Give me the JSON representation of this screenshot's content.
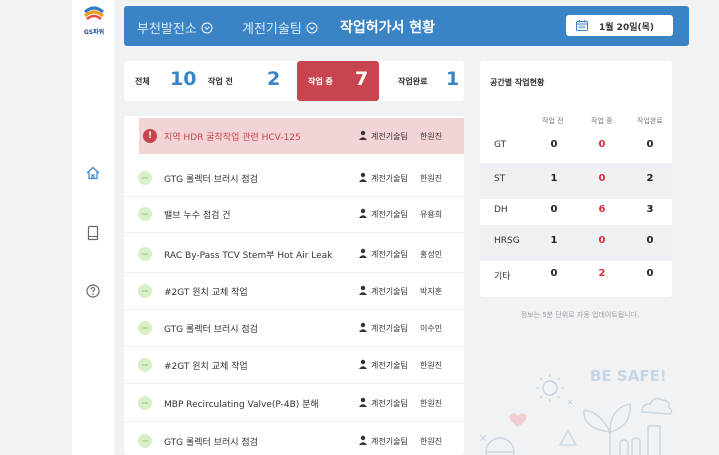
{
  "brand": {
    "logo_text": "GS파워"
  },
  "header": {
    "plant": "부천발전소",
    "team": "계전기술팀",
    "title": "작업허가서 현황",
    "date": "1월 20일(목)"
  },
  "tabs": [
    {
      "label": "전체",
      "count": "10"
    },
    {
      "label": "작업 전",
      "count": "2"
    },
    {
      "label": "작업 중",
      "count": "7",
      "active": true
    },
    {
      "label": "작업완료",
      "count": "1"
    }
  ],
  "works": [
    {
      "title": "지역 HDR 굴착작업 관련 HCV-125",
      "team": "계전기술팀",
      "name": "한원진",
      "alert": true
    },
    {
      "title": "GTG 롤렉터 브러시 점검",
      "team": "계전기술팀",
      "name": "한원진"
    },
    {
      "title": "밸브 누수 점검 건",
      "team": "계전기술팀",
      "name": "유용희"
    },
    {
      "title": "RAC By-Pass TCV Stem부 Hot Air Leak",
      "team": "계전기술팀",
      "name": "홍성민"
    },
    {
      "title": "#2GT 윈치 교체 작업",
      "team": "계전기술팀",
      "name": "박지훈"
    },
    {
      "title": "GTG 롤렉터 브러시 점검",
      "team": "계전기술팀",
      "name": "이수민"
    },
    {
      "title": "#2GT 윈치 교체 작업",
      "team": "계전기술팀",
      "name": "한원진"
    },
    {
      "title": "MBP Recirculating Valve(P-4B) 분해",
      "team": "계전기술팀",
      "name": "한원진"
    },
    {
      "title": "GTG 롤렉터 브러시 점검",
      "team": "계전기술팀",
      "name": "한원진"
    }
  ],
  "area_panel": {
    "title": "공간별 작업현황",
    "columns": [
      "작업 전",
      "작업 중",
      "작업완료"
    ],
    "rows": [
      {
        "name": "GT",
        "before": "0",
        "during": "0",
        "done": "0"
      },
      {
        "name": "ST",
        "before": "1",
        "during": "0",
        "done": "2"
      },
      {
        "name": "DH",
        "before": "0",
        "during": "6",
        "done": "3"
      },
      {
        "name": "HRSG",
        "before": "1",
        "during": "0",
        "done": "0"
      },
      {
        "name": "기타",
        "before": "0",
        "during": "2",
        "done": "0"
      }
    ],
    "note": "정보는 5분 단위로 자동 업데이트됩니다."
  },
  "safety": {
    "text": "BE SAFE!"
  },
  "icons": {
    "sidebar": [
      "home-icon",
      "tablet-icon",
      "help-icon"
    ],
    "header": [
      "chevron-circle-icon",
      "calendar-icon"
    ],
    "rows": [
      "alert-icon",
      "work-status-icon",
      "person-icon"
    ]
  },
  "colors": {
    "header_bg": "#3a83c5",
    "accent_red": "#c8454f",
    "alert_row_bg": "#f2d3d6",
    "count_blue": "#3a83c5",
    "status_icon_green": "#d8efc8"
  }
}
